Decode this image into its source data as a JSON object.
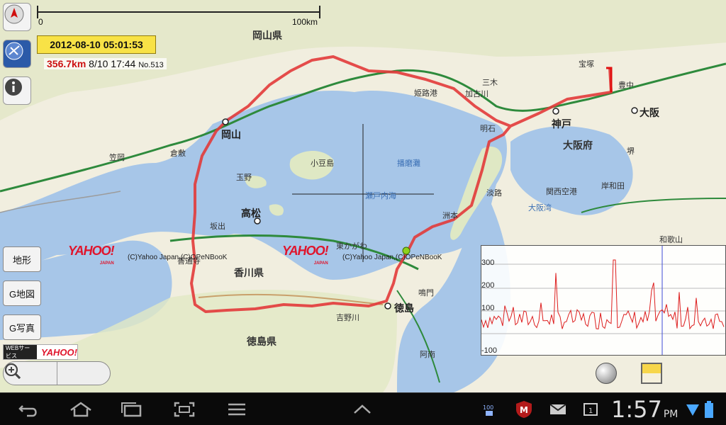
{
  "scale": {
    "start": "0",
    "end": "100km"
  },
  "track": {
    "datetime": "2012-08-10 05:01:53",
    "distance": "356.7km",
    "time": "8/10 17:44",
    "number": "No.513"
  },
  "side_buttons": {
    "terrain": "地形",
    "gmap": "G地図",
    "gphoto": "G写真"
  },
  "web_service": {
    "label": "WEBサービス",
    "logo": "YAHOO!"
  },
  "logo": {
    "text": "YAHOO!",
    "sub": "JAPAN"
  },
  "copyright": "(C)Yahoo Japan,(C)OPeNBooK",
  "graph": {
    "y_labels": [
      "300",
      "200",
      "100",
      "-100"
    ]
  },
  "map_labels": {
    "okayama_pref": "岡山県",
    "kagawa_pref": "香川県",
    "tokushima_pref": "徳島県",
    "osaka_pref": "大阪府",
    "okayama": "岡山",
    "takamatsu": "高松",
    "tokushima": "徳島",
    "kobe": "神戸",
    "osaka": "大阪",
    "himeji": "姫路港",
    "akashi": "明石",
    "awaji": "淡路",
    "shodoshima": "小豆島",
    "sumoto": "洲本",
    "naruto": "鳴門",
    "seto_inland_sea": "瀬戸内海",
    "harima_nada": "播磨灘",
    "osaka_bay": "大阪湾",
    "kurashiki": "倉敷",
    "tamano": "玉野",
    "sakaide": "坂出",
    "kasaoka": "笠岡",
    "kagawa": "善通寺",
    "higashikagawa": "東かがわ",
    "miki": "三木",
    "kakogawa": "加古川",
    "sakai": "堺",
    "kishiwada": "岸和田",
    "kaizuka": "関西空港",
    "toyonaka": "豊中",
    "takarazuka": "宝塚",
    "wakayama": "和歌山",
    "anan": "阿南",
    "yoshinogawa": "吉野川"
  },
  "status": {
    "time": "1:57",
    "ampm": "PM"
  },
  "nav": [
    "back",
    "home",
    "recent",
    "screenshot",
    "menu"
  ]
}
